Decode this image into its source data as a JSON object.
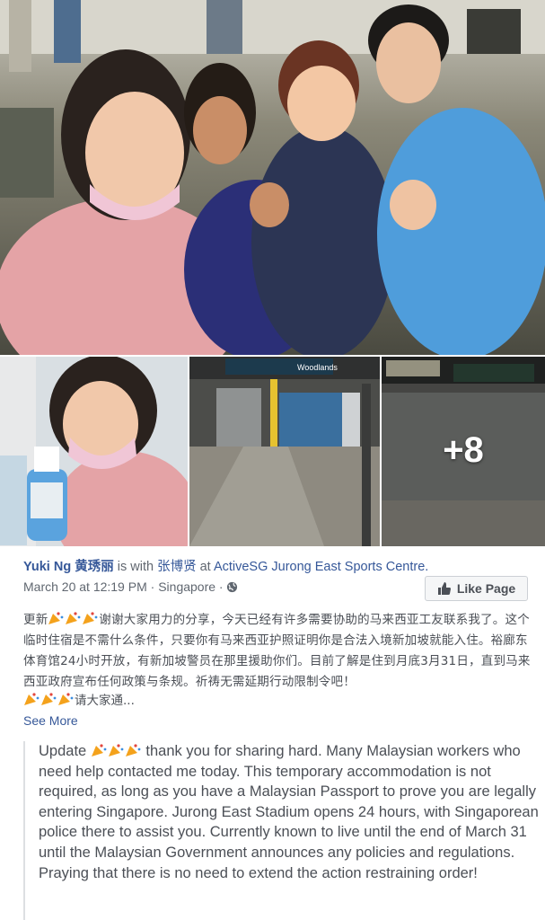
{
  "post": {
    "author": "Yuki Ng 黄琇丽",
    "is_with": "is with",
    "tagged": "张博贤",
    "at": "at",
    "location": "ActiveSG Jurong East Sports Centre.",
    "timestamp": "March 20 at 12:19 PM",
    "separator": "·",
    "place": "Singapore",
    "privacy_icon": "globe-icon",
    "more_photos": "+8",
    "like_page_label": "Like Page",
    "cn_prefix": "更新",
    "cn_body": "谢谢大家用力的分享，今天已经有许多需要协助的马来西亚工友联系我了。这个临时住宿是不需什么条件，只要你有马来西亚护照证明你是合法入境新加坡就能入住。裕廊东体育馆24小时开放，有新加坡警员在那里援助你们。目前了解是住到月底3月31日，直到马来西亚政府宣布任何政策与条规。祈祷无需延期行动限制令吧！",
    "cn_more": "请大家通...",
    "see_more": "See More",
    "translation_prefix": "Update",
    "translation_body": "thank you for sharing hard. Many Malaysian workers who need help contacted me today. This temporary accommodation is not required, as long as you have a Malaysian Passport to prove you are legally entering Singapore. Jurong East Stadium opens 24 hours, with Singaporean police there to assist you. Currently known to live until the end of March 31 until the Malaysian Government announces any policies and regulations. Praying that there is no need to extend the action restraining order!",
    "emoji_icon": "party-popper-icon"
  },
  "photos": {
    "sign_label": "Woodlands"
  },
  "colors": {
    "link": "#365899",
    "meta": "#606770",
    "body": "#4b4f56"
  }
}
